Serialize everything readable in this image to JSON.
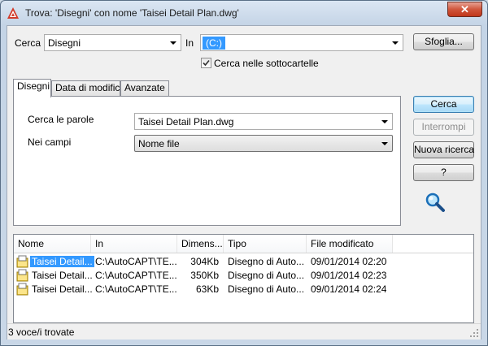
{
  "window": {
    "title": "Trova: 'Disegni' con nome 'Taisei Detail Plan.dwg'",
    "close_glyph": "✕"
  },
  "search": {
    "cerca_label": "Cerca",
    "cerca_value": "Disegni",
    "in_label": "In",
    "in_value": "(C:)",
    "browse_label": "Sfoglia...",
    "subfolders_label": "Cerca nelle sottocartelle",
    "subfolders_checked": true
  },
  "tabs": [
    {
      "label": "Disegni",
      "active": true
    },
    {
      "label": "Data di modifica",
      "active": false
    },
    {
      "label": "Avanzate",
      "active": false
    }
  ],
  "form": {
    "words_label": "Cerca le parole",
    "words_value": "Taisei Detail Plan.dwg",
    "fields_label": "Nei campi",
    "fields_value": "Nome file"
  },
  "actions": {
    "find": "Cerca",
    "stop": "Interrompi",
    "new_search": "Nuova ricerca",
    "help": "?"
  },
  "results": {
    "columns": [
      "Nome",
      "In",
      "Dimens...",
      "Tipo",
      "File modificato"
    ],
    "rows": [
      {
        "name": "Taisei Detail...",
        "in": "C:\\AutoCAPT\\TE...",
        "size": "304Kb",
        "type": "Disegno di Auto...",
        "modified": "09/01/2014 02:20",
        "selected": true
      },
      {
        "name": "Taisei Detail...",
        "in": "C:\\AutoCAPT\\TE...",
        "size": "350Kb",
        "type": "Disegno di Auto...",
        "modified": "09/01/2014 02:23",
        "selected": false
      },
      {
        "name": "Taisei Detail...",
        "in": "C:\\AutoCAPT\\TE...",
        "size": "63Kb",
        "type": "Disegno di Auto...",
        "modified": "09/01/2014 02:24",
        "selected": false
      }
    ]
  },
  "status": {
    "text": "3 voce/i trovate"
  },
  "colors": {
    "selection": "#3399ff",
    "accent_red": "#c0361a"
  }
}
